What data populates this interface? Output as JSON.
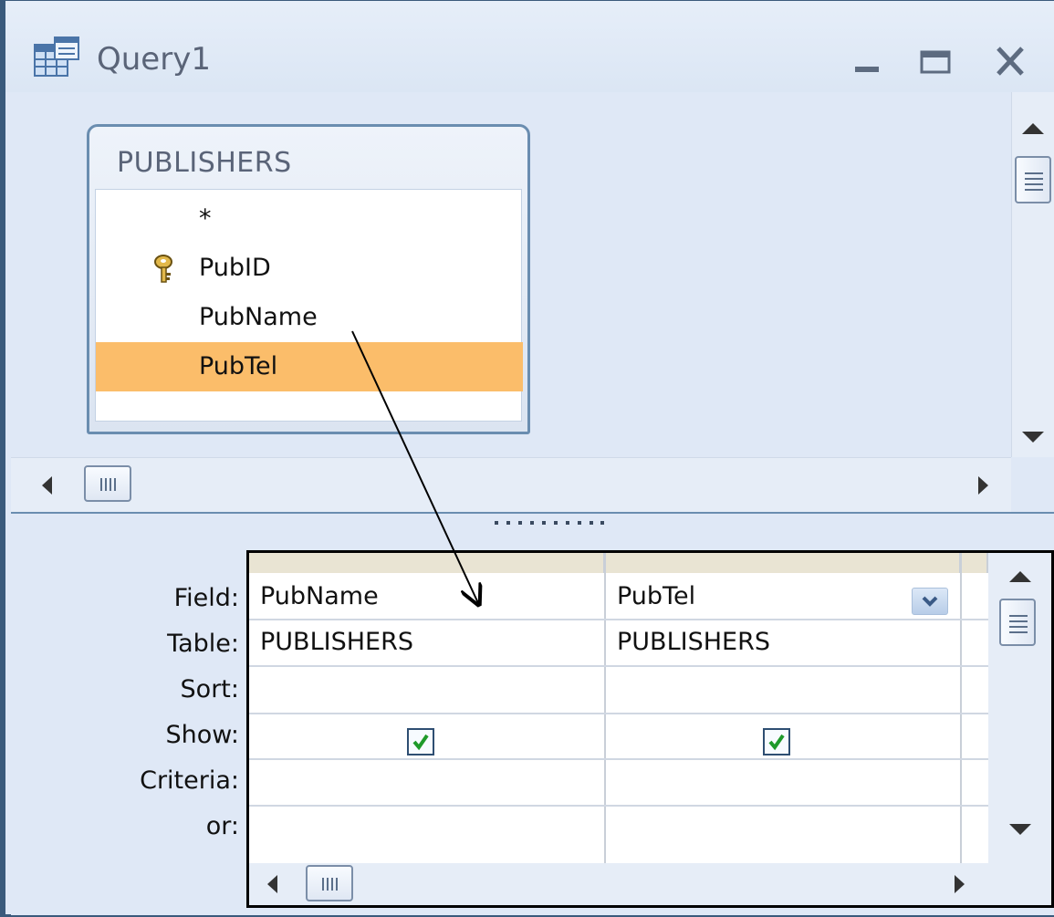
{
  "window": {
    "title": "Query1"
  },
  "table": {
    "name": "PUBLISHERS",
    "fields": [
      {
        "label": "*",
        "key": false,
        "selected": false
      },
      {
        "label": "PubID",
        "key": true,
        "selected": false
      },
      {
        "label": "PubName",
        "key": false,
        "selected": false
      },
      {
        "label": "PubTel",
        "key": false,
        "selected": true
      }
    ]
  },
  "grid": {
    "row_labels": [
      "Field:",
      "Table:",
      "Sort:",
      "Show:",
      "Criteria:",
      "or:"
    ],
    "columns": [
      {
        "field": "PubName",
        "table": "PUBLISHERS",
        "sort": "",
        "show": true,
        "criteria": "",
        "or": ""
      },
      {
        "field": "PubTel",
        "table": "PUBLISHERS",
        "sort": "",
        "show": true,
        "criteria": "",
        "or": ""
      }
    ]
  },
  "icons": {
    "title": "query-design-icon",
    "key": "primary-key-icon",
    "minimize": "minimize-icon",
    "maximize": "maximize-icon",
    "close": "close-icon",
    "dropdown": "chevron-down-icon",
    "check": "check-icon"
  },
  "colors": {
    "selected_field": "#fbbd6a",
    "window_bg": "#dfe8f6",
    "border": "#6a8db0",
    "check": "#1e9a2a"
  }
}
